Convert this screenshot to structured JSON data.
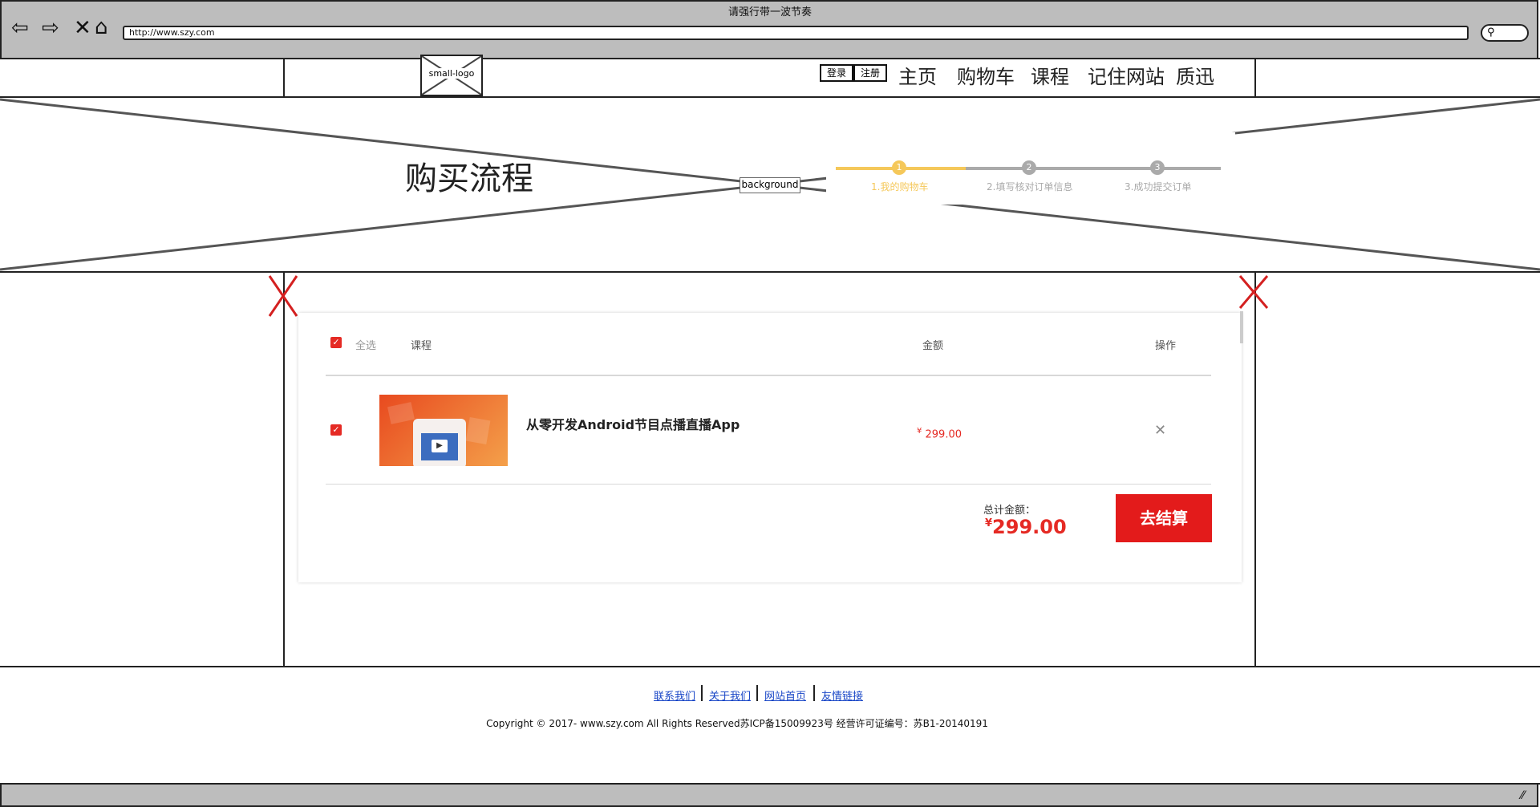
{
  "browser": {
    "window_title": "请强行带一波节奏",
    "url": "http://www.szy.com"
  },
  "header": {
    "logo_label": "small-logo",
    "login": "登录",
    "register": "注册",
    "nav": [
      "主页",
      "购物车",
      "课程",
      "记住网站",
      "质迅"
    ]
  },
  "banner": {
    "title": "购买流程",
    "background_label": "background",
    "steps": [
      {
        "num": "1",
        "label": "1.我的购物车",
        "active": true
      },
      {
        "num": "2",
        "label": "2.填写核对订单信息",
        "active": false
      },
      {
        "num": "3",
        "label": "3.成功提交订单",
        "active": false
      }
    ],
    "active_color": "#f5c85a",
    "inactive_color": "#aaaaaa"
  },
  "cart": {
    "select_all": "全选",
    "col_course": "课程",
    "col_amount": "金额",
    "col_action": "操作",
    "items": [
      {
        "title": "从零开发Android节目点播直播App",
        "currency": "¥",
        "price": "299.00"
      }
    ],
    "total_label": "总计金额：",
    "total_currency": "¥",
    "total_amount": "299.00",
    "checkout_label": "去结算",
    "accent": "#e31b1b"
  },
  "footer": {
    "links": [
      "联系我们",
      "关于我们",
      "网站首页",
      "友情链接"
    ],
    "copyright": "Copyright © 2017- www.szy.com All Rights Reserved苏ICP备15009923号 经营许可证编号：苏B1-20140191"
  }
}
